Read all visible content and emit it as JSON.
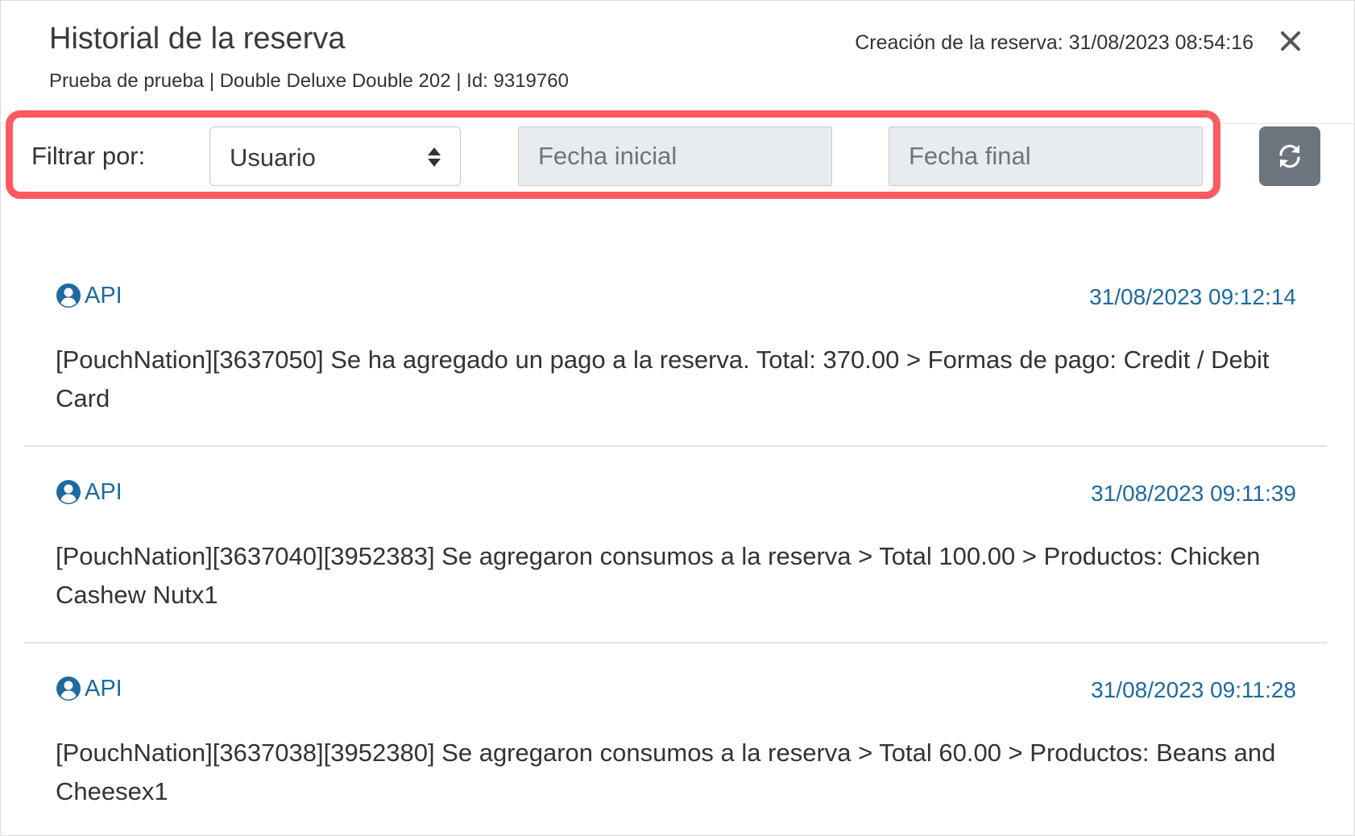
{
  "header": {
    "title": "Historial de la reserva",
    "subtitle": "Prueba de prueba | Double Deluxe Double 202 | Id: 9319760",
    "creation": "Creación de la reserva: 31/08/2023 08:54:16"
  },
  "filter": {
    "label": "Filtrar por:",
    "select_value": "Usuario",
    "start_placeholder": "Fecha inicial",
    "end_placeholder": "Fecha final",
    "highlight_color": "#ff5a5f"
  },
  "icons": {
    "close": "close-icon",
    "select_arrows": "sort-arrows-icon",
    "refresh": "refresh-icon",
    "user": "user-circle-icon"
  },
  "colors": {
    "accent": "#1d6aa0",
    "refresh_button": "#6c757d",
    "input_disabled_bg": "#e9ecef"
  },
  "entries": [
    {
      "user": "API",
      "timestamp": "31/08/2023 09:12:14",
      "text": "[PouchNation][3637050] Se ha agregado un pago a la reserva. Total: 370.00 > Formas de pago: Credit / Debit Card"
    },
    {
      "user": "API",
      "timestamp": "31/08/2023 09:11:39",
      "text": "[PouchNation][3637040][3952383] Se agregaron consumos a la reserva > Total 100.00 > Productos: Chicken Cashew Nutx1"
    },
    {
      "user": "API",
      "timestamp": "31/08/2023 09:11:28",
      "text": "[PouchNation][3637038][3952380] Se agregaron consumos a la reserva > Total 60.00 > Productos: Beans and Cheesex1"
    }
  ]
}
